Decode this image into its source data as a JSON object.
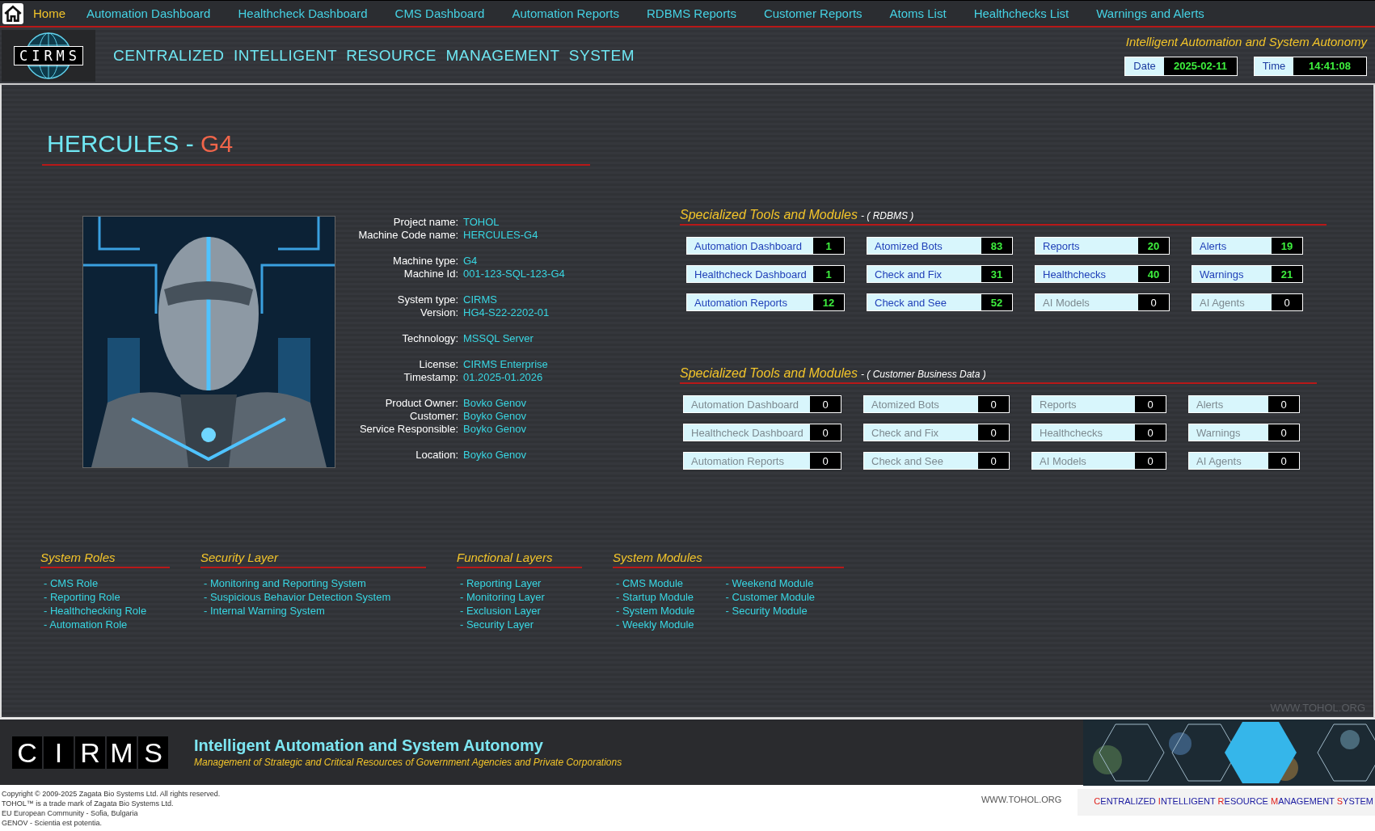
{
  "nav": [
    {
      "label": "Home",
      "selected": true
    },
    {
      "label": "Automation Dashboard",
      "selected": false
    },
    {
      "label": "Healthcheck Dashboard",
      "selected": false
    },
    {
      "label": "CMS Dashboard",
      "selected": false
    },
    {
      "label": "Automation Reports",
      "selected": false
    },
    {
      "label": "RDBMS Reports",
      "selected": false
    },
    {
      "label": "Customer Reports",
      "selected": false
    },
    {
      "label": "Atoms List",
      "selected": false
    },
    {
      "label": "Healthchecks List",
      "selected": false
    },
    {
      "label": "Warnings and Alerts",
      "selected": false
    }
  ],
  "header": {
    "logo": "CIRMS",
    "title": "CENTRALIZED  INTELLIGENT  RESOURCE  MANAGEMENT  SYSTEM",
    "slogan": "Intelligent Automation and System Autonomy",
    "date_label": "Date",
    "date": "2025-02-11",
    "time_label": "Time",
    "time": "14:41:08"
  },
  "machine": {
    "name": "HERCULES",
    "separator": "-",
    "code": "G4"
  },
  "info_groups": [
    [
      {
        "label": "Project name:",
        "value": "TOHOL"
      },
      {
        "label": "Machine Code name:",
        "value": "HERCULES-G4"
      }
    ],
    [
      {
        "label": "Machine type:",
        "value": "G4"
      },
      {
        "label": "Machine Id:",
        "value": "001-123-SQL-123-G4"
      }
    ],
    [
      {
        "label": "System type:",
        "value": "CIRMS"
      },
      {
        "label": "Version:",
        "value": "HG4-S22-2202-01"
      }
    ],
    [
      {
        "label": "Technology:",
        "value": "MSSQL Server"
      }
    ],
    [
      {
        "label": "License:",
        "value": "CIRMS Enterprise"
      },
      {
        "label": "Timestamp:",
        "value": "01.2025-01.2026"
      }
    ],
    [
      {
        "label": "Product Owner:",
        "value": "Bovko Genov"
      },
      {
        "label": "Customer:",
        "value": "Boyko Genov"
      },
      {
        "label": "Service Responsible:",
        "value": "Boyko Genov"
      }
    ],
    [
      {
        "label": "Location:",
        "value": "Boyko Genov"
      }
    ]
  ],
  "tool_sections": [
    {
      "title": "Specialized Tools and Modules",
      "subtitle": "- ( RDBMS )",
      "tiles": [
        {
          "label": "Automation Dashboard",
          "count": "1",
          "active": true
        },
        {
          "label": "Atomized Bots",
          "count": "83",
          "active": true
        },
        {
          "label": "Reports",
          "count": "20",
          "active": true
        },
        {
          "label": "Alerts",
          "count": "19",
          "active": true
        },
        {
          "label": "Healthcheck Dashboard",
          "count": "1",
          "active": true
        },
        {
          "label": "Check and Fix",
          "count": "31",
          "active": true
        },
        {
          "label": "Healthchecks",
          "count": "40",
          "active": true
        },
        {
          "label": "Warnings",
          "count": "21",
          "active": true
        },
        {
          "label": "Automation Reports",
          "count": "12",
          "active": true
        },
        {
          "label": "Check and See",
          "count": "52",
          "active": true
        },
        {
          "label": "AI Models",
          "count": "0",
          "active": false
        },
        {
          "label": "AI Agents",
          "count": "0",
          "active": false
        }
      ]
    },
    {
      "title": "Specialized Tools and Modules",
      "subtitle": "- ( Customer Business Data )",
      "tiles": [
        {
          "label": "Automation Dashboard",
          "count": "0",
          "active": false
        },
        {
          "label": "Atomized Bots",
          "count": "0",
          "active": false
        },
        {
          "label": "Reports",
          "count": "0",
          "active": false
        },
        {
          "label": "Alerts",
          "count": "0",
          "active": false
        },
        {
          "label": "Healthcheck Dashboard",
          "count": "0",
          "active": false
        },
        {
          "label": "Check and Fix",
          "count": "0",
          "active": false
        },
        {
          "label": "Healthchecks",
          "count": "0",
          "active": false
        },
        {
          "label": "Warnings",
          "count": "0",
          "active": false
        },
        {
          "label": "Automation Reports",
          "count": "0",
          "active": false
        },
        {
          "label": "Check and See",
          "count": "0",
          "active": false
        },
        {
          "label": "AI Models",
          "count": "0",
          "active": false
        },
        {
          "label": "AI Agents",
          "count": "0",
          "active": false
        }
      ]
    }
  ],
  "lists": [
    {
      "title": "System Roles",
      "columns": [
        [
          "- CMS Role",
          "- Reporting Role",
          "- Healthchecking Role",
          "- Automation Role"
        ]
      ]
    },
    {
      "title": "Security Layer",
      "columns": [
        [
          "- Monitoring and Reporting System",
          "- Suspicious Behavior Detection System",
          "- Internal Warning System"
        ]
      ]
    },
    {
      "title": "Functional Layers",
      "columns": [
        [
          "- Reporting Layer",
          "- Monitoring Layer",
          "- Exclusion Layer",
          "- Security Layer"
        ]
      ]
    },
    {
      "title": "System Modules",
      "columns": [
        [
          "- CMS Module",
          "- Startup Module",
          "- System Module",
          "- Weekly Module"
        ],
        [
          "- Weekend Module",
          "- Customer Module",
          "- Security Module"
        ]
      ]
    }
  ],
  "site_mark": "WWW.TOHOL.ORG",
  "footer": {
    "logo_letters": [
      "C",
      "I",
      "R",
      "M",
      "S"
    ],
    "slogan": "Intelligent Automation and System Autonomy",
    "tagline": "Management of Strategic and Critical Resources of Government Agencies and Private Corporations"
  },
  "bottom": {
    "copyright": [
      "Copyright © 2009-2025 Zagata Bio Systems Ltd. All rights reserved.",
      "TOHOL™ is a trade mark of Zagata Bio Systems Ltd.",
      "EU European Community - Sofia, Bulgaria",
      "GENOV - Scientia est potentia."
    ],
    "site": "WWW.TOHOL.ORG",
    "system_words": [
      "CENTRALIZED",
      "INTELLIGENT",
      "RESOURCE",
      "MANAGEMENT",
      "SYSTEM"
    ]
  }
}
